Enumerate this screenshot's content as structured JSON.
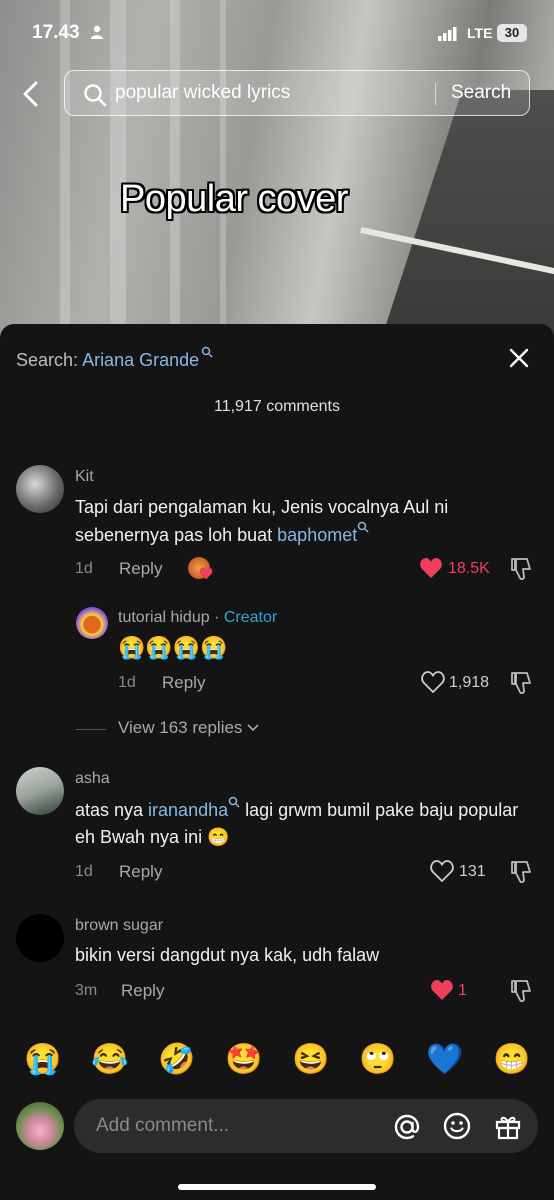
{
  "status_bar": {
    "time": "17.43",
    "network": "LTE",
    "battery": "30"
  },
  "search_bar": {
    "query": "popular wicked lyrics",
    "button": "Search"
  },
  "video": {
    "overlay_title": "Popular cover"
  },
  "comments_sheet": {
    "search_label": "Search:",
    "search_query": "Ariana Grande",
    "comment_count": "11,917 comments",
    "comments": [
      {
        "author": "Kit",
        "text_main": "Tapi dari pengalaman ku, Jenis vocalnya Aul ni sebenernya pas loh buat ",
        "mention": "baphomet",
        "time": "1d",
        "reply": "Reply",
        "likes": "18.5K",
        "liked": true
      },
      {
        "author": "tutorial hidup",
        "sep": " · ",
        "badge": "Creator",
        "text": "😭😭😭😭",
        "time": "1d",
        "reply": "Reply",
        "likes": "1,918",
        "liked": false
      },
      {
        "view_replies": "View 163 replies"
      },
      {
        "author": "asha",
        "text_pre": "atas nya ",
        "mention": "iranandha",
        "text_post": " lagi grwm bumil pake baju popular eh Bwah nya ini 😁",
        "time": "1d",
        "reply": "Reply",
        "likes": "131",
        "liked": false
      },
      {
        "author": "brown sugar",
        "text": "bikin versi dangdut nya kak, udh falaw",
        "time": "3m",
        "reply": "Reply",
        "likes": "1",
        "liked": true
      }
    ],
    "quick_emojis": [
      "😭",
      "😂",
      "🤣",
      "🤩",
      "😆",
      "🙄",
      "💙",
      "😁"
    ],
    "input_placeholder": "Add comment..."
  },
  "colors": {
    "like_red": "#ef3f5d",
    "link_blue": "#8ab6e6",
    "creator_blue": "#2ea8d0"
  }
}
